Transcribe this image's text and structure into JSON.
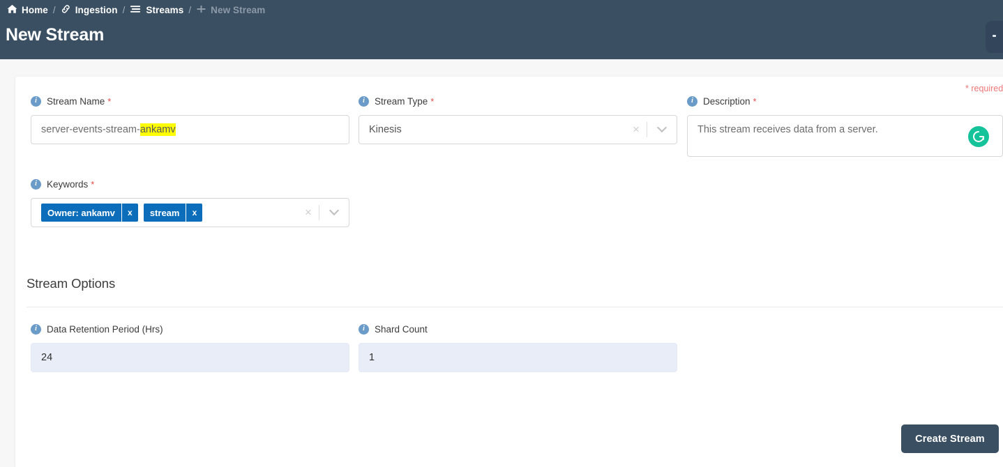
{
  "header": {
    "title": "New Stream",
    "background_color": "#3b4f63",
    "breadcrumb": [
      {
        "label": "Home",
        "icon": "home-icon",
        "muted": false
      },
      {
        "label": "Ingestion",
        "icon": "link-icon",
        "muted": false
      },
      {
        "label": "Streams",
        "icon": "list-icon",
        "muted": false
      },
      {
        "label": "New Stream",
        "icon": "plus-icon",
        "muted": true
      }
    ],
    "separator": "/"
  },
  "form": {
    "required_note": "* required",
    "required_marker": "*",
    "stream_name": {
      "label": "Stream Name",
      "value_prefix": "server-events-stream-",
      "value_highlight": "ankamv",
      "required": true,
      "info_icon": "info-icon"
    },
    "stream_type": {
      "label": "Stream Type",
      "value": "Kinesis",
      "required": true,
      "clear_icon": "×",
      "dropdown_icon": "chevron-down-icon"
    },
    "description": {
      "label": "Description",
      "value": "This stream receives data from a server.",
      "required": true,
      "assistant_icon": "grammarly-icon",
      "assistant_color": "#15c39a"
    },
    "keywords": {
      "label": "Keywords",
      "required": true,
      "tag_color": "#0c6eba",
      "tags": [
        {
          "label": "Owner: ankamv",
          "remove": "x"
        },
        {
          "label": "stream",
          "remove": "x"
        }
      ],
      "clear_icon": "×",
      "dropdown_icon": "chevron-down-icon"
    }
  },
  "stream_options": {
    "section_title": "Stream Options",
    "data_retention": {
      "label": "Data Retention Period (Hrs)",
      "value": "24",
      "required": false
    },
    "shard_count": {
      "label": "Shard Count",
      "value": "1",
      "required": false
    }
  },
  "actions": {
    "create_button": "Create Stream"
  }
}
